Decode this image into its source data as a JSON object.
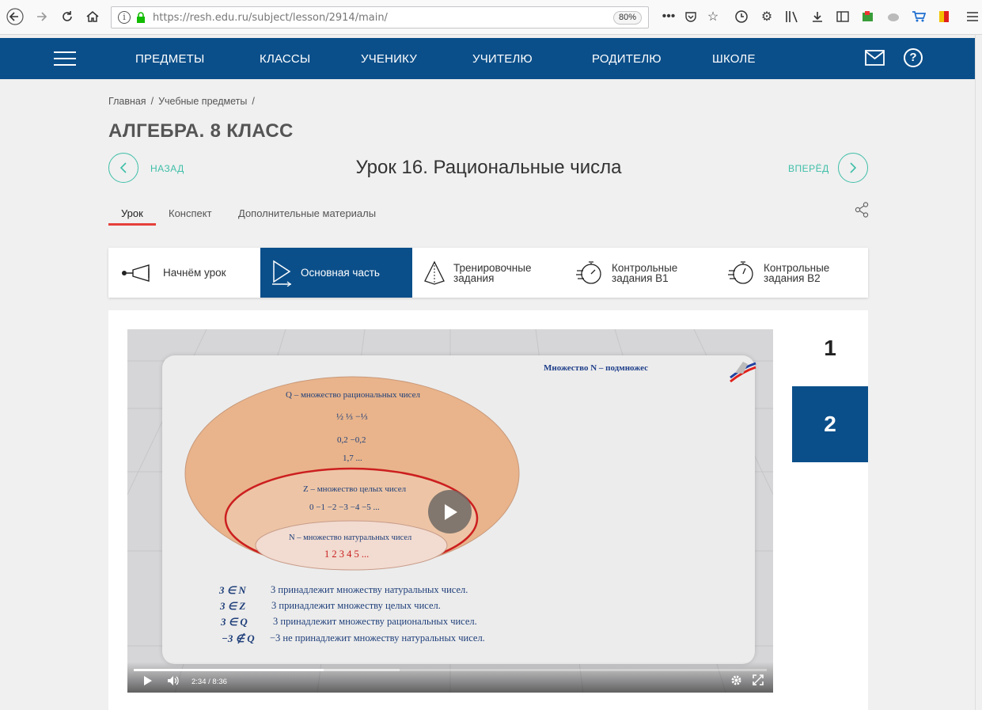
{
  "browser": {
    "url": "https://resh.edu.ru/subject/lesson/2914/main/",
    "zoom": "80%"
  },
  "header": {
    "nav": [
      "ПРЕДМЕТЫ",
      "КЛАССЫ",
      "УЧЕНИКУ",
      "УЧИТЕЛЮ",
      "РОДИТЕЛЮ",
      "ШКОЛЕ"
    ]
  },
  "breadcrumb": {
    "home": "Главная",
    "subjects": "Учебные предметы",
    "sep": "/"
  },
  "subject_title": "АЛГЕБРА. 8 КЛАСС",
  "lesson": {
    "back": "НАЗАД",
    "forward": "ВПЕРЁД",
    "title": "Урок 16. Рациональные числа"
  },
  "tabs": [
    "Урок",
    "Конспект",
    "Дополнительные материалы"
  ],
  "stages": [
    {
      "line1": "Начнём урок",
      "line2": ""
    },
    {
      "line1": "Основная часть",
      "line2": ""
    },
    {
      "line1": "Тренировочные",
      "line2": "задания"
    },
    {
      "line1": "Контрольные",
      "line2": "задания В1"
    },
    {
      "line1": "Контрольные",
      "line2": "задания В2"
    }
  ],
  "slide": {
    "heading": "Множество N – подмножес",
    "q_label": "Q – множество рациональных чисел",
    "q_row1": "½   ⅓  −⅓",
    "q_row2": "0,2   −0,2",
    "q_row3": "1,7   ...",
    "z_label": "Z – множество целых чисел",
    "z_row": "0   −1   −2   −3   −4   −5  ...",
    "n_label": "N – множество натуральных чисел",
    "n_row": "1  2  3  4  5  ...",
    "statements": [
      {
        "sym": "3 ∈ N",
        "text": "3 принадлежит множеству натуральных чисел."
      },
      {
        "sym": "3 ∈ Z",
        "text": "3 принадлежит множеству целых чисел."
      },
      {
        "sym": "3 ∈ Q",
        "text": "3 принадлежит множеству рациональных чисел."
      },
      {
        "sym": "−3 ∉ Q",
        "text": "−3 не принадлежит множеству натуральных чисел."
      }
    ]
  },
  "player": {
    "current": "2:34",
    "sep": "/",
    "duration": "8:36",
    "progress": 0.3,
    "buffered": 0.42
  },
  "slides_nav": [
    "1",
    "2"
  ],
  "colors": {
    "brand": "#0b4f8a",
    "accent": "#3fbfa8",
    "tab_underline": "#e5413a"
  }
}
